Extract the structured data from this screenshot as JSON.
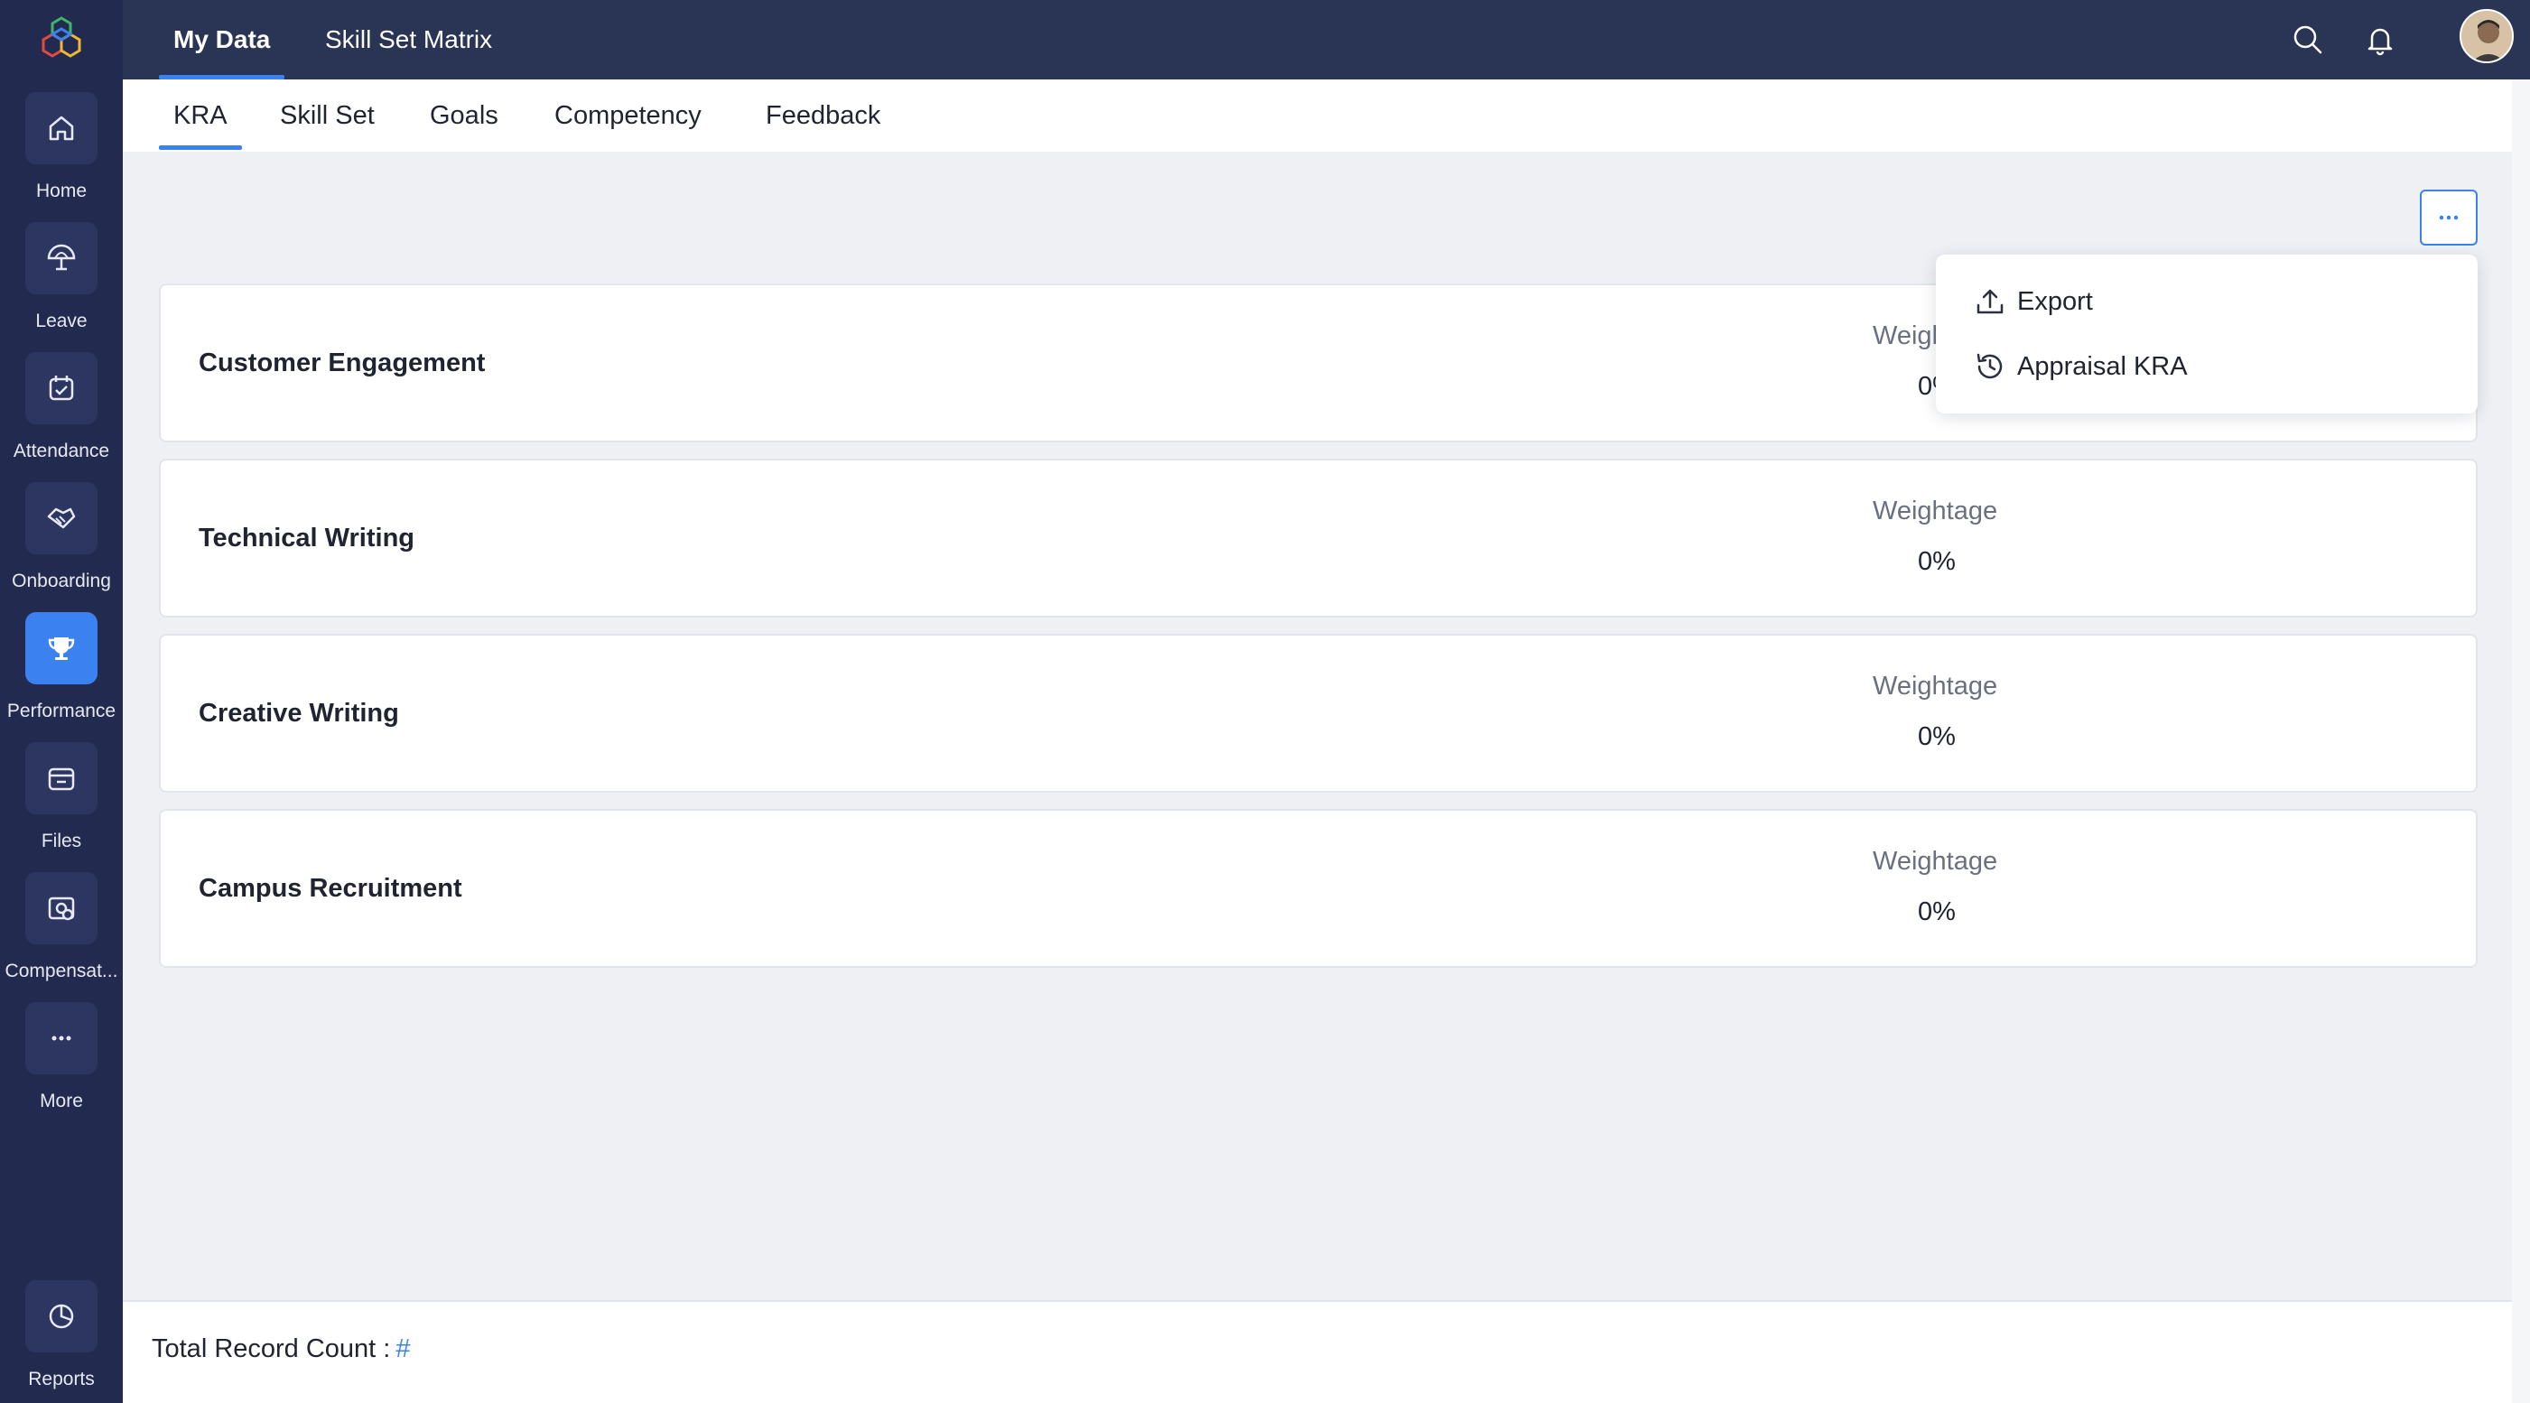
{
  "sidebar": {
    "items": [
      {
        "label": "Home",
        "icon": "home-icon"
      },
      {
        "label": "Leave",
        "icon": "umbrella-icon"
      },
      {
        "label": "Attendance",
        "icon": "calendar-check-icon"
      },
      {
        "label": "Onboarding",
        "icon": "handshake-icon"
      },
      {
        "label": "Performance",
        "icon": "trophy-icon",
        "active": true
      },
      {
        "label": "Files",
        "icon": "folder-icon"
      },
      {
        "label": "Compensat...",
        "icon": "compensation-icon"
      },
      {
        "label": "More",
        "icon": "more-dots-icon"
      },
      {
        "label": "Reports",
        "icon": "pie-chart-icon"
      }
    ]
  },
  "header": {
    "tabs": [
      {
        "label": "My Data",
        "active": true
      },
      {
        "label": "Skill Set Matrix",
        "active": false
      }
    ]
  },
  "subtabs": [
    {
      "label": "KRA",
      "active": true
    },
    {
      "label": "Skill Set"
    },
    {
      "label": "Goals"
    },
    {
      "label": "Competency"
    },
    {
      "label": "Feedback"
    }
  ],
  "kra_list": [
    {
      "title": "Customer Engagement",
      "weight_label": "Weightage",
      "weight_value": "0%"
    },
    {
      "title": "Technical Writing",
      "weight_label": "Weightage",
      "weight_value": "0%"
    },
    {
      "title": "Creative Writing",
      "weight_label": "Weightage",
      "weight_value": "0%"
    },
    {
      "title": "Campus Recruitment",
      "weight_label": "Weightage",
      "weight_value": "0%"
    }
  ],
  "dropdown": {
    "items": [
      {
        "label": "Export",
        "icon": "upload-icon"
      },
      {
        "label": "Appraisal KRA",
        "icon": "history-icon"
      }
    ]
  },
  "footer": {
    "label": "Total Record Count :",
    "count": "#"
  },
  "colors": {
    "sidebar_bg": "#222b4f",
    "topbar_bg": "#2a3454",
    "accent": "#3b82f0"
  }
}
